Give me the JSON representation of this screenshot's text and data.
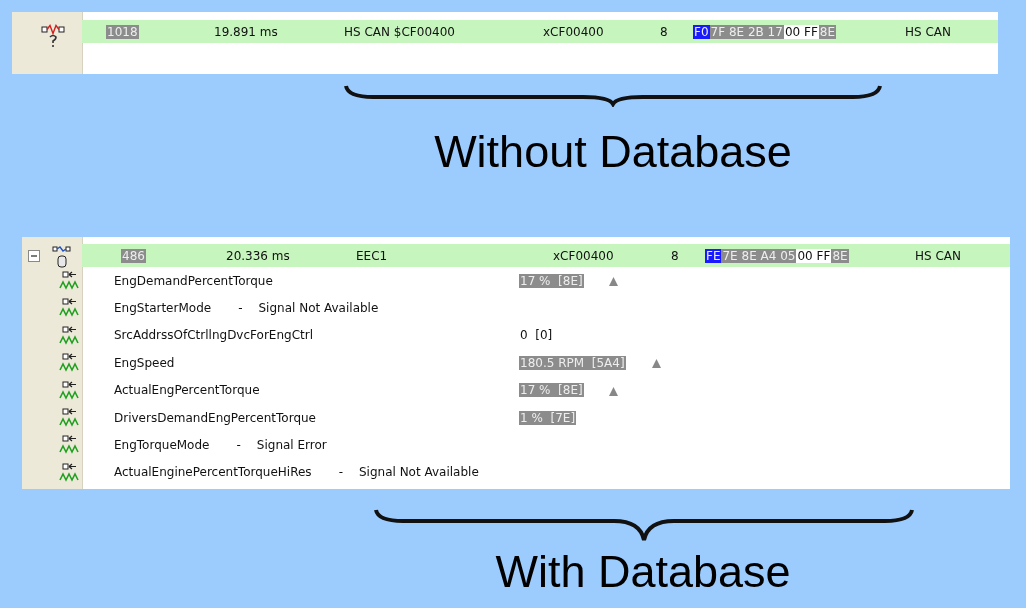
{
  "without_database": {
    "message": {
      "number": "1018",
      "time": "19.891 ms",
      "name": "HS CAN $CF00400",
      "id": "xCF00400",
      "dlc": "8",
      "bytes": [
        {
          "text": "F0",
          "kind": "selected"
        },
        {
          "text": "7F 8E 2B 17",
          "kind": "changed"
        },
        {
          "text": "00 FF",
          "kind": "plain"
        },
        {
          "text": "8E",
          "kind": "changed"
        }
      ],
      "bus": "HS CAN"
    },
    "caption": "Without Database"
  },
  "with_database": {
    "message": {
      "number": "486",
      "time": "20.336 ms",
      "name": "EEC1",
      "id": "xCF00400",
      "dlc": "8",
      "expanded": true,
      "bytes": [
        {
          "text": "FE",
          "kind": "selected"
        },
        {
          "text": "7E 8E A4 05",
          "kind": "changed"
        },
        {
          "text": "00 FF",
          "kind": "plain"
        },
        {
          "text": "8E",
          "kind": "changed"
        }
      ],
      "bus": "HS CAN"
    },
    "signals": [
      {
        "name": "EngDemandPercentTorque",
        "value": "17 %  [8E]",
        "changed": true,
        "rising": true
      },
      {
        "name": "EngStarterMode",
        "dash": "-",
        "status": "Signal Not Available"
      },
      {
        "name": "SrcAddrssOfCtrllngDvcForEngCtrl",
        "value": "0  [0]",
        "changed": false,
        "rising": false
      },
      {
        "name": "EngSpeed",
        "value": "180.5 RPM  [5A4]",
        "changed": true,
        "rising": true
      },
      {
        "name": "ActualEngPercentTorque",
        "value": "17 %  [8E]",
        "changed": true,
        "rising": true
      },
      {
        "name": "DriversDemandEngPercentTorque",
        "value": "1 %  [7E]",
        "changed": true,
        "rising": false
      },
      {
        "name": "EngTorqueMode",
        "dash": "-",
        "status": "Signal Error"
      },
      {
        "name": "ActualEnginePercentTorqueHiRes",
        "dash": "-",
        "status": "Signal Not Available"
      }
    ],
    "caption": "With Database"
  }
}
